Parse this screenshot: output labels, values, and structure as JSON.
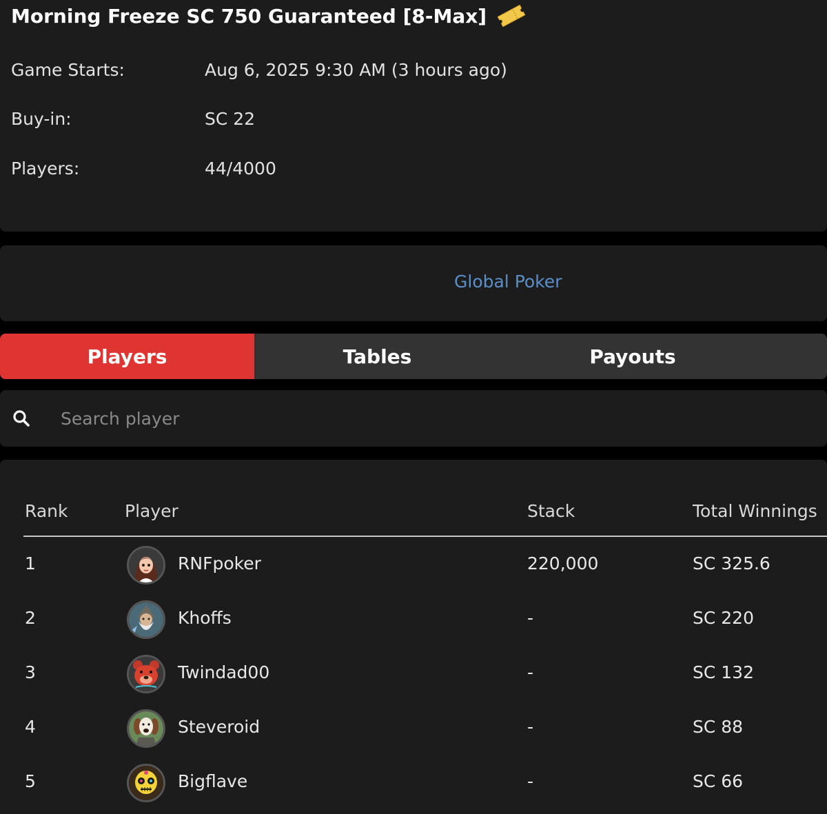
{
  "tournament": {
    "title": "Morning Freeze SC 750 Guaranteed [8-Max]",
    "icon": "ticket-icon",
    "rows": [
      {
        "label": "Game Starts:",
        "value": "Aug 6, 2025 9:30 AM (3 hours ago)"
      },
      {
        "label": "Buy-in:",
        "value": "SC 22"
      },
      {
        "label": "Players:",
        "value": "44/4000"
      }
    ]
  },
  "brand": {
    "link_text": "Global Poker",
    "color": "#5b8fc9"
  },
  "tabs": [
    {
      "label": "Players",
      "active": true
    },
    {
      "label": "Tables",
      "active": false
    },
    {
      "label": "Payouts",
      "active": false
    }
  ],
  "search": {
    "placeholder": "Search player",
    "value": "",
    "icon": "search-icon"
  },
  "table": {
    "headers": {
      "rank": "Rank",
      "player": "Player",
      "stack": "Stack",
      "winnings": "Total Winnings"
    },
    "rows": [
      {
        "rank": "1",
        "player": "RNFpoker",
        "stack": "220,000",
        "winnings": "SC 325.6",
        "avatar": "avatar-girl"
      },
      {
        "rank": "2",
        "player": "Khoffs",
        "stack": "-",
        "winnings": "SC 220",
        "avatar": "avatar-wizard"
      },
      {
        "rank": "3",
        "player": "Twindad00",
        "stack": "-",
        "winnings": "SC 132",
        "avatar": "avatar-red-bear"
      },
      {
        "rank": "4",
        "player": "Steveroid",
        "stack": "-",
        "winnings": "SC 88",
        "avatar": "avatar-dog"
      },
      {
        "rank": "5",
        "player": "Bigflave",
        "stack": "-",
        "winnings": "SC 66",
        "avatar": "avatar-sugar-skull"
      }
    ]
  },
  "colors": {
    "accent": "#de3533",
    "card": "#1c1c1c",
    "tab_inactive": "#333333"
  }
}
